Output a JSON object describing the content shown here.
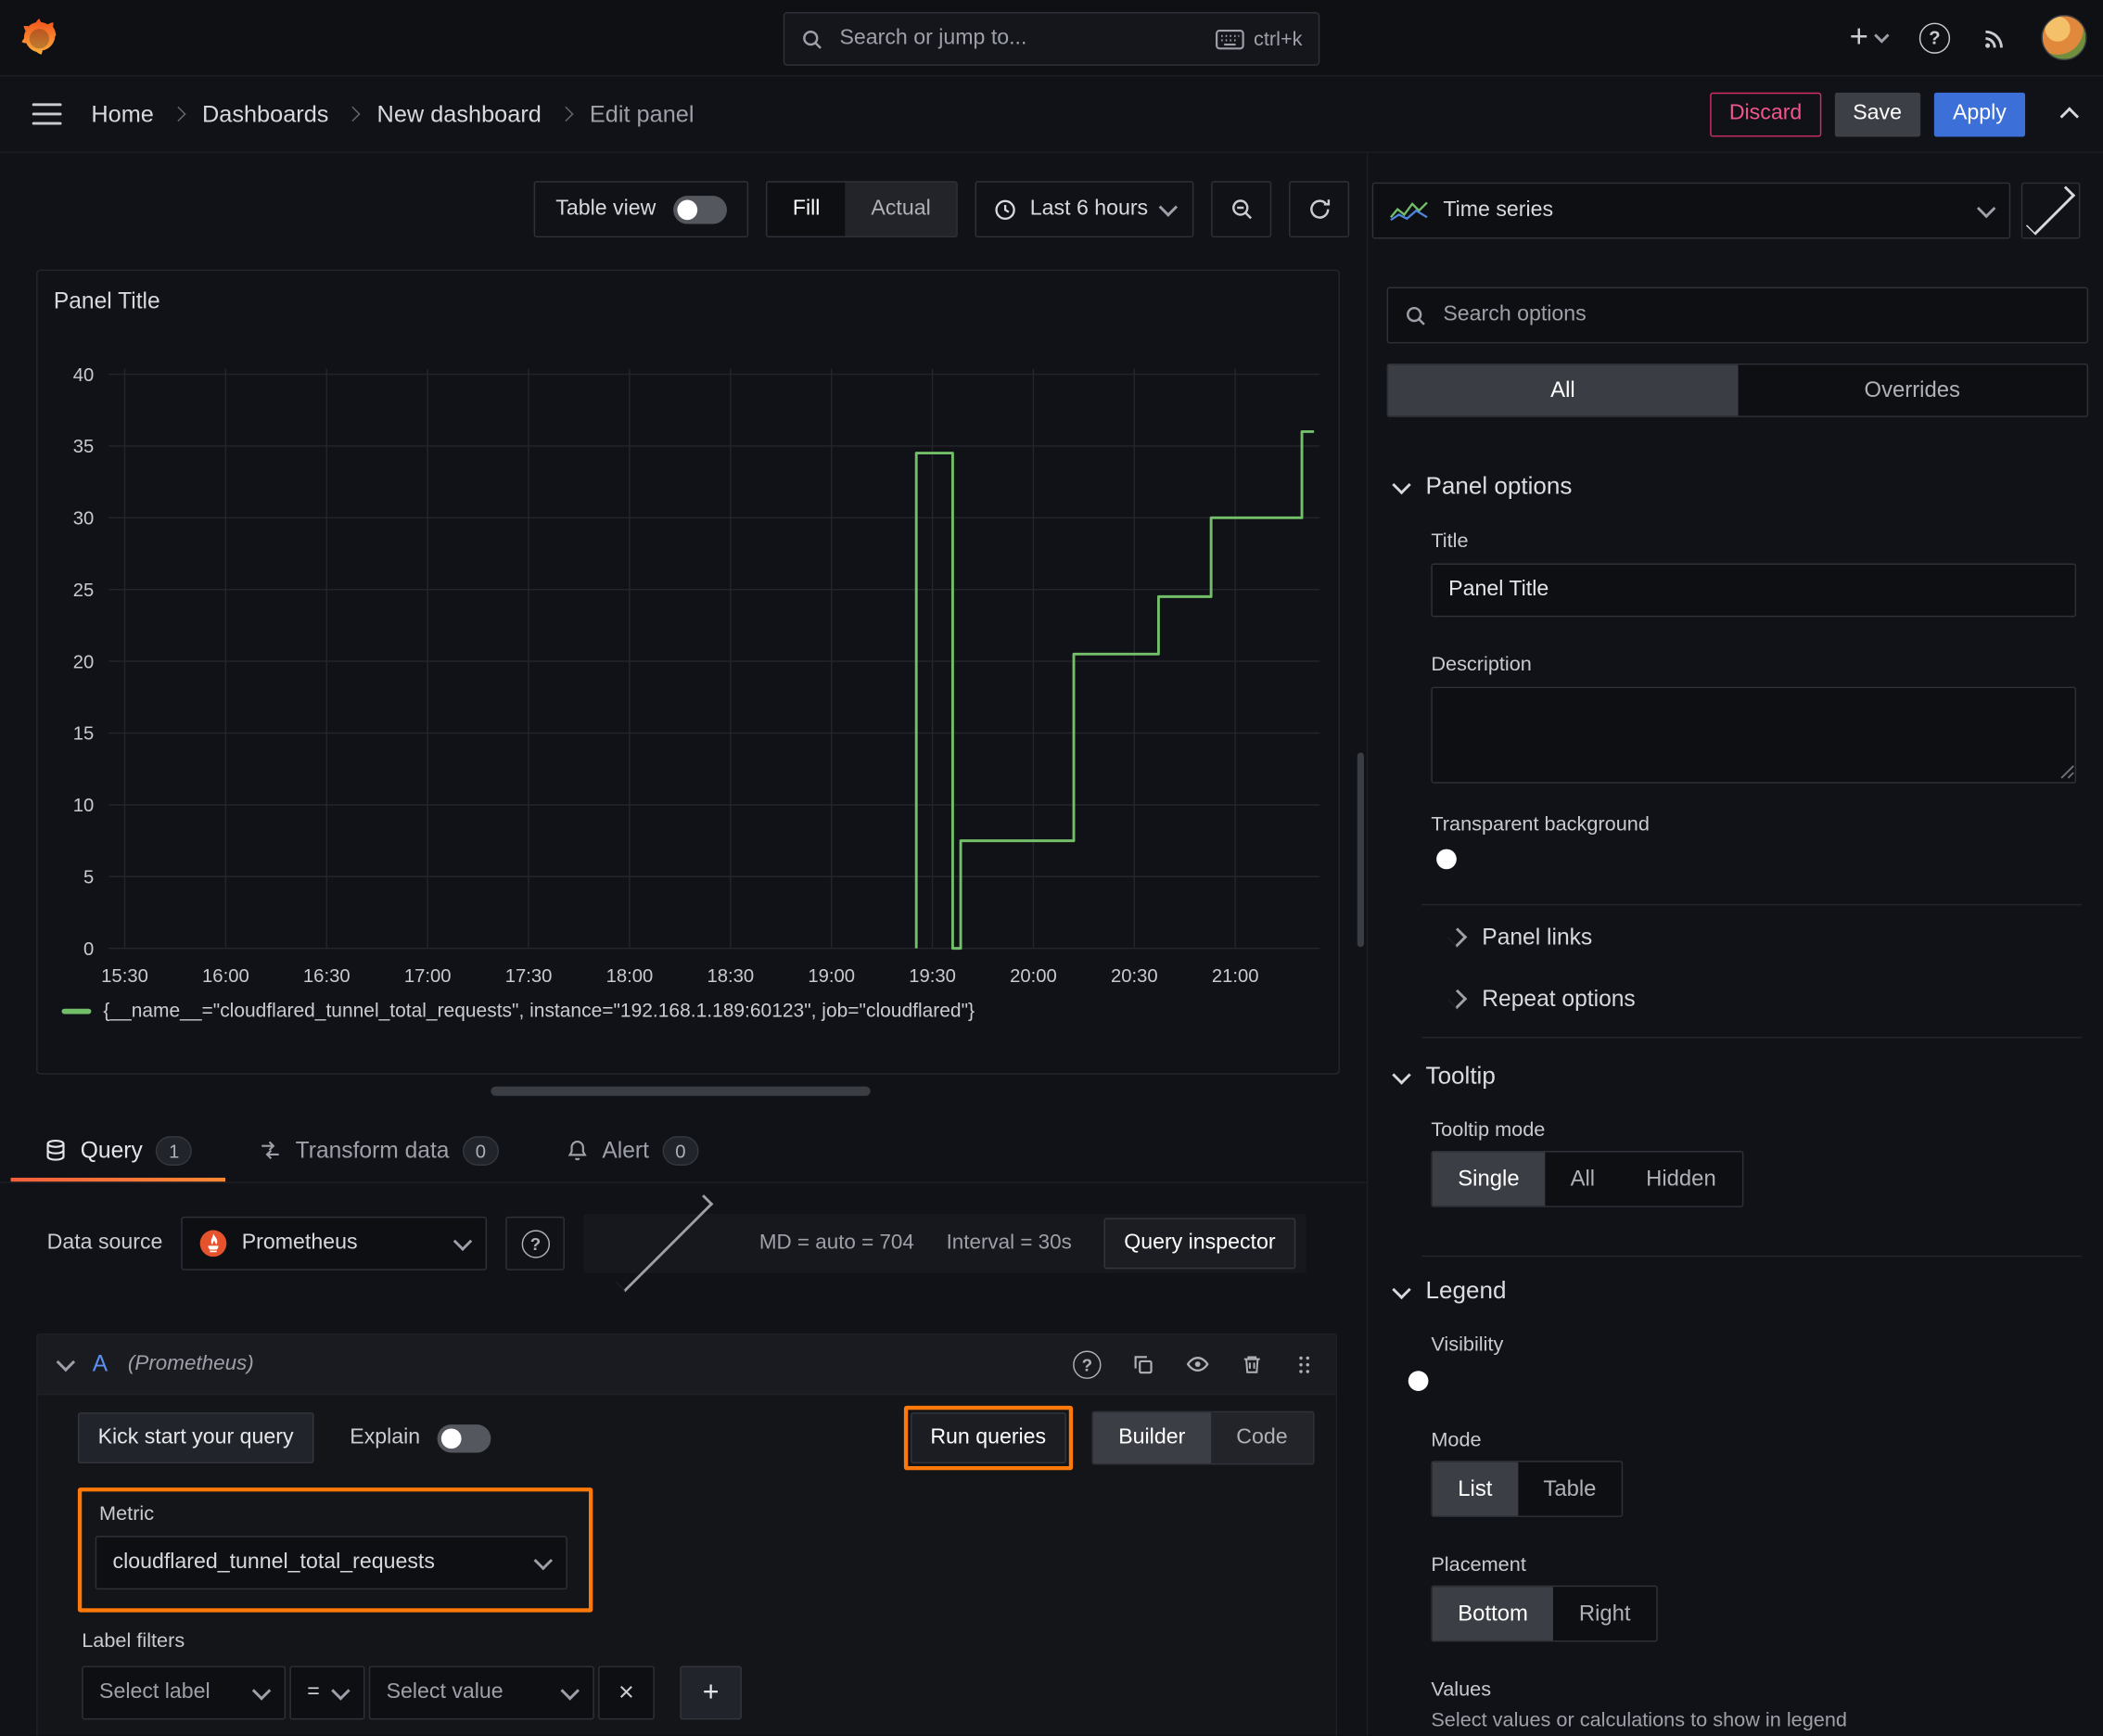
{
  "topbar": {
    "search_placeholder": "Search or jump to...",
    "shortcut": "ctrl+k"
  },
  "breadcrumb": {
    "items": [
      "Home",
      "Dashboards",
      "New dashboard",
      "Edit panel"
    ],
    "discard_label": "Discard",
    "save_label": "Save",
    "apply_label": "Apply"
  },
  "toolbar": {
    "table_view_label": "Table view",
    "fill_label": "Fill",
    "actual_label": "Actual",
    "time_range_label": "Last 6 hours"
  },
  "panel": {
    "title": "Panel Title",
    "legend_label": "{__name__=\"cloudflared_tunnel_total_requests\", instance=\"192.168.1.189:60123\", job=\"cloudflared\"}"
  },
  "chart_data": {
    "type": "line",
    "title": "Panel Title",
    "series": [
      {
        "name": "{__name__=\"cloudflared_tunnel_total_requests\", instance=\"192.168.1.189:60123\", job=\"cloudflared\"}",
        "points_hours_value": [
          [
            19.42,
            0
          ],
          [
            19.42,
            34.5
          ],
          [
            19.6,
            34.5
          ],
          [
            19.6,
            0
          ],
          [
            19.64,
            0
          ],
          [
            19.64,
            7.5
          ],
          [
            20.2,
            7.5
          ],
          [
            20.2,
            20.5
          ],
          [
            20.62,
            20.5
          ],
          [
            20.62,
            24.5
          ],
          [
            20.88,
            24.5
          ],
          [
            20.88,
            30
          ],
          [
            21.33,
            30
          ],
          [
            21.33,
            36
          ],
          [
            21.39,
            36
          ]
        ]
      }
    ],
    "x_ticks": [
      "15:30",
      "16:00",
      "16:30",
      "17:00",
      "17:30",
      "18:00",
      "18:30",
      "19:00",
      "19:30",
      "20:00",
      "20:30",
      "21:00"
    ],
    "x_tick_hours": [
      15.5,
      16,
      16.5,
      17,
      17.5,
      18,
      18.5,
      19,
      19.5,
      20,
      20.5,
      21
    ],
    "x_range_hours": [
      15.42,
      21.43
    ],
    "y_ticks": [
      0,
      5,
      10,
      15,
      20,
      25,
      30,
      35,
      40
    ],
    "y_range": [
      0,
      40
    ],
    "grid": true,
    "legend_position": "bottom",
    "line_color": "#73bf69"
  },
  "editor_tabs": {
    "query_label": "Query",
    "query_count": "1",
    "transform_label": "Transform data",
    "transform_count": "0",
    "alert_label": "Alert",
    "alert_count": "0"
  },
  "query": {
    "datasource_label": "Data source",
    "datasource_value": "Prometheus",
    "max_data_points": "MD = auto = 704",
    "interval": "Interval = 30s",
    "inspector_label": "Query inspector",
    "ref_id": "A",
    "ref_datasource": "(Prometheus)",
    "kickstart_label": "Kick start your query",
    "explain_label": "Explain",
    "run_label": "Run queries",
    "builder_label": "Builder",
    "code_label": "Code",
    "metric_label": "Metric",
    "metric_value": "cloudflared_tunnel_total_requests",
    "label_filters_label": "Label filters",
    "select_label_placeholder": "Select label",
    "operator_value": "=",
    "select_value_placeholder": "Select value"
  },
  "options": {
    "viz_type": "Time series",
    "search_placeholder": "Search options",
    "tab_all": "All",
    "tab_overrides": "Overrides",
    "panel_options": "Panel options",
    "title_label": "Title",
    "title_value": "Panel Title",
    "description_label": "Description",
    "transparent_label": "Transparent background",
    "panel_links": "Panel links",
    "repeat_options": "Repeat options",
    "tooltip": "Tooltip",
    "tooltip_mode": "Tooltip mode",
    "mode_single": "Single",
    "mode_all": "All",
    "mode_hidden": "Hidden",
    "legend": "Legend",
    "visibility_label": "Visibility",
    "mode_label": "Mode",
    "legend_list": "List",
    "legend_table": "Table",
    "placement_label": "Placement",
    "placement_bottom": "Bottom",
    "placement_right": "Right",
    "values_label": "Values",
    "values_hint": "Select values or calculations to show in legend"
  },
  "icons": {
    "plus": "+",
    "question": "?",
    "close": "×",
    "add": "+"
  },
  "colors": {
    "accent_orange": "#ff780a",
    "apply_blue": "#3d71d9",
    "discard_red": "#d12f63",
    "series_green": "#73bf69",
    "toggle_blue": "#3871dc",
    "background": "#111217"
  }
}
